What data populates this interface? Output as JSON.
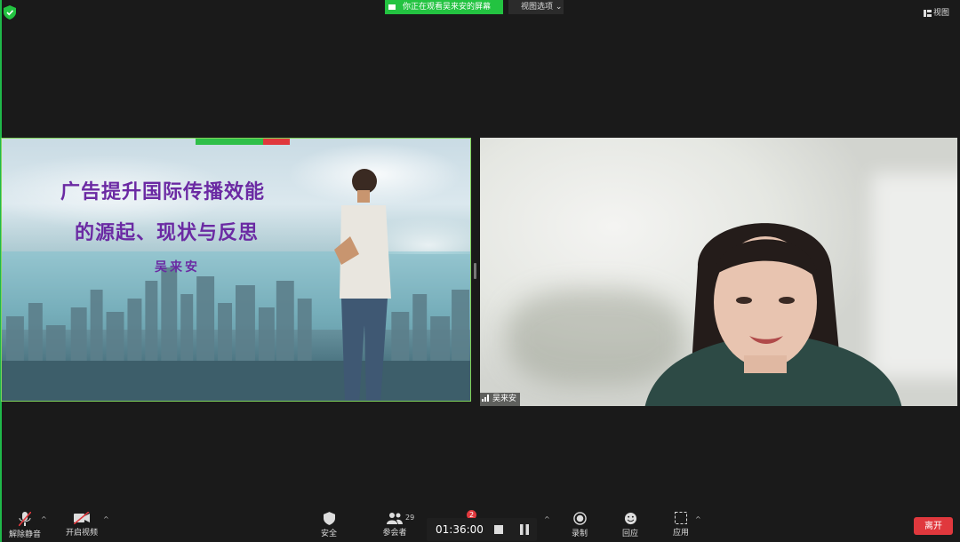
{
  "top_bar": {
    "viewing_banner": "你正在观看吴来安的屏幕",
    "view_options_label": "视图选项",
    "view_button_label": "视图"
  },
  "shared_screen": {
    "slide_title_line1": "广告提升国际传播效能",
    "slide_title_line2": "的源起、现状与反思",
    "slide_author": "吴来安"
  },
  "video_tile": {
    "participant_name": "吴来安"
  },
  "toolbar": {
    "unmute_label": "解除静音",
    "start_video_label": "开启视频",
    "security_label": "安全",
    "participants_label": "参会者",
    "participants_count": "29",
    "chat_badge_count": "2",
    "record_label": "录制",
    "reactions_label": "回应",
    "apps_label": "应用",
    "leave_label": "离开",
    "recording_timer": "01:36:00"
  },
  "colors": {
    "accent_green": "#23c341",
    "leave_red": "#e0383d",
    "slide_title_purple": "#6b2aa3"
  }
}
